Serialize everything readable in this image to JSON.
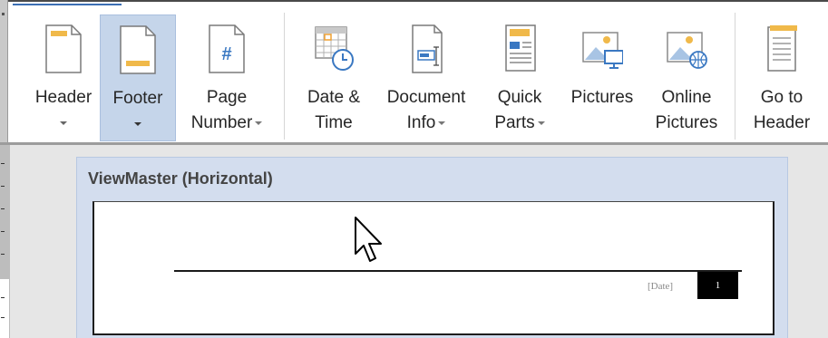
{
  "ribbon": {
    "buttons": [
      {
        "id": "header",
        "line1": "Header",
        "line2": "",
        "dropdown": true,
        "icon": "header-icon",
        "selected": false
      },
      {
        "id": "footer",
        "line1": "Footer",
        "line2": "",
        "dropdown": true,
        "icon": "footer-icon",
        "selected": true
      },
      {
        "id": "page-number",
        "line1": "Page",
        "line2": "Number",
        "dropdown": true,
        "icon": "page-number-icon",
        "selected": false
      },
      {
        "id": "date-time",
        "line1": "Date &",
        "line2": "Time",
        "dropdown": false,
        "icon": "date-time-icon",
        "selected": false
      },
      {
        "id": "document-info",
        "line1": "Document",
        "line2": "Info",
        "dropdown": true,
        "icon": "document-info-icon",
        "selected": false
      },
      {
        "id": "quick-parts",
        "line1": "Quick",
        "line2": "Parts",
        "dropdown": true,
        "icon": "quick-parts-icon",
        "selected": false
      },
      {
        "id": "pictures",
        "line1": "Pictures",
        "line2": "",
        "dropdown": false,
        "icon": "pictures-icon",
        "selected": false
      },
      {
        "id": "online-pictures",
        "line1": "Online",
        "line2": "Pictures",
        "dropdown": false,
        "icon": "online-pictures-icon",
        "selected": false
      },
      {
        "id": "go-to-header",
        "line1": "Go to",
        "line2": "Header",
        "dropdown": false,
        "icon": "go-to-header-icon",
        "selected": false
      }
    ],
    "page_number_glyph": "#"
  },
  "gallery": {
    "item_title": "ViewMaster (Horizontal)",
    "preview": {
      "date_placeholder": "[Date]",
      "page_number": "1"
    }
  },
  "colors": {
    "selected_bg": "#c5d5ea",
    "gallery_bg": "#d3ddee",
    "icon_accent": "#f0b94a",
    "icon_blue": "#3a78c2"
  }
}
